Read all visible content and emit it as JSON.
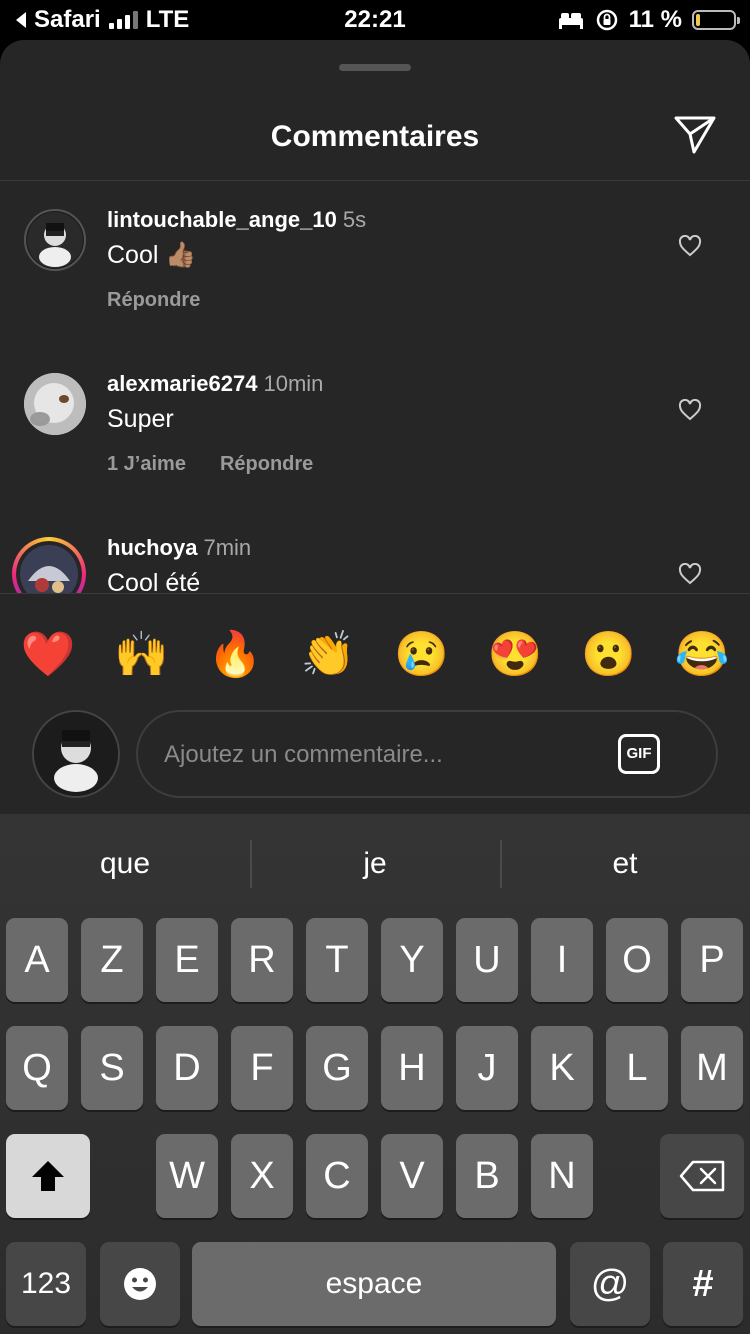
{
  "status_bar": {
    "back_app": "Safari",
    "network": "LTE",
    "time": "22:21",
    "battery_text": "11 %"
  },
  "sheet": {
    "title": "Commentaires"
  },
  "comments": [
    {
      "username": "lintouchable_ange_10",
      "time": "5s",
      "text": "Cool 👍🏽",
      "likes": "",
      "reply": "Répondre"
    },
    {
      "username": "alexmarie6274",
      "time": "10min",
      "text": "Super",
      "likes": "1 J’aime",
      "reply": "Répondre"
    },
    {
      "username": "huchoya",
      "time": "7min",
      "text": "Cool été",
      "likes": "",
      "reply": ""
    }
  ],
  "quick_reactions": [
    "❤️",
    "🙌",
    "🔥",
    "👏",
    "😢",
    "😍",
    "😮",
    "😂"
  ],
  "composer": {
    "placeholder": "Ajoutez un commentaire...",
    "gif_label": "GIF"
  },
  "keyboard": {
    "suggestions": [
      "que",
      "je",
      "et"
    ],
    "row1": [
      "A",
      "Z",
      "E",
      "R",
      "T",
      "Y",
      "U",
      "I",
      "O",
      "P"
    ],
    "row2": [
      "Q",
      "S",
      "D",
      "F",
      "G",
      "H",
      "J",
      "K",
      "L",
      "M"
    ],
    "row3": [
      "W",
      "X",
      "C",
      "V",
      "B",
      "N"
    ],
    "numbers_label": "123",
    "space_label": "espace",
    "at_label": "@",
    "hash_label": "#"
  }
}
